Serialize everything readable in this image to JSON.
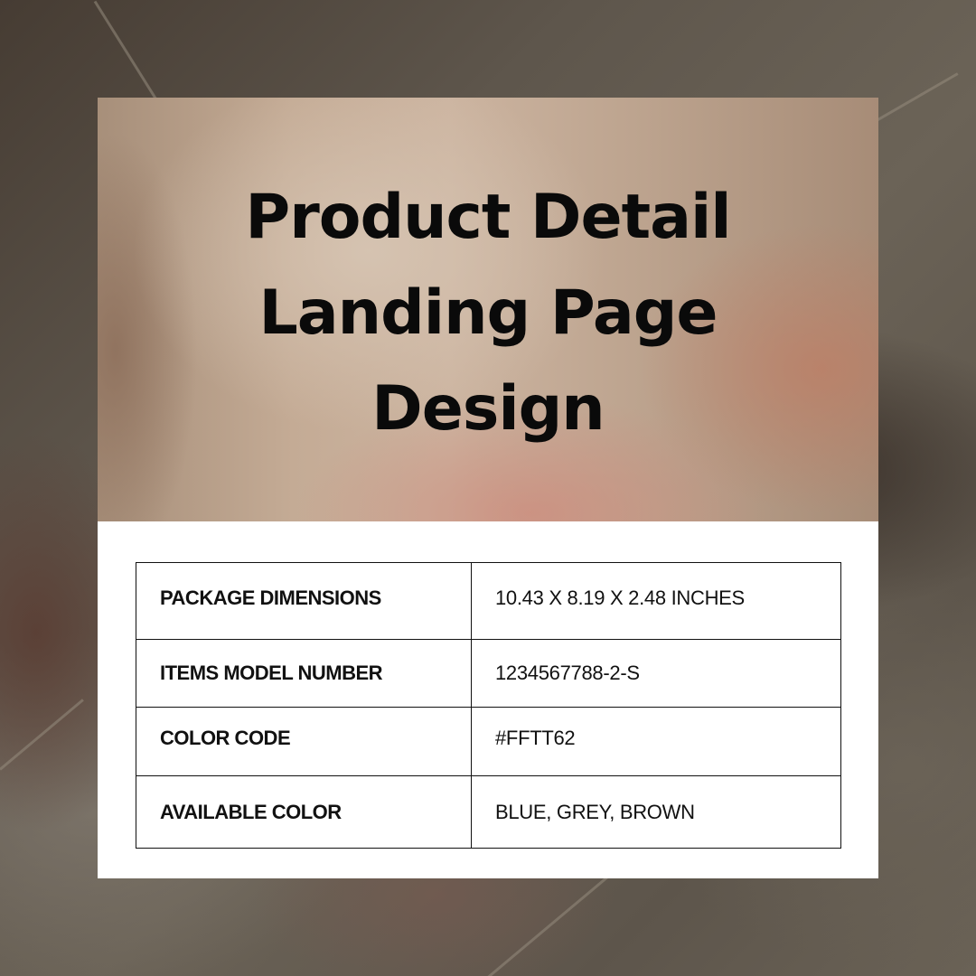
{
  "hero": {
    "title_lines": [
      "Product Detail",
      "Landing Page",
      "Design"
    ]
  },
  "specs": {
    "rows": [
      {
        "label": "PACKAGE DIMENSIONS",
        "value": "10.43 X 8.19 X 2.48 INCHES"
      },
      {
        "label": "ITEMS MODEL NUMBER",
        "value": "1234567788-2-S"
      },
      {
        "label": "COLOR CODE",
        "value": "#FFTT62"
      },
      {
        "label": "AVAILABLE COLOR",
        "value": "BLUE, GREY, BROWN"
      }
    ]
  },
  "colors": {
    "card_background": "#ffffff",
    "text": "#0a0a0a",
    "table_border": "#111111",
    "page_background": "#5a5248"
  }
}
